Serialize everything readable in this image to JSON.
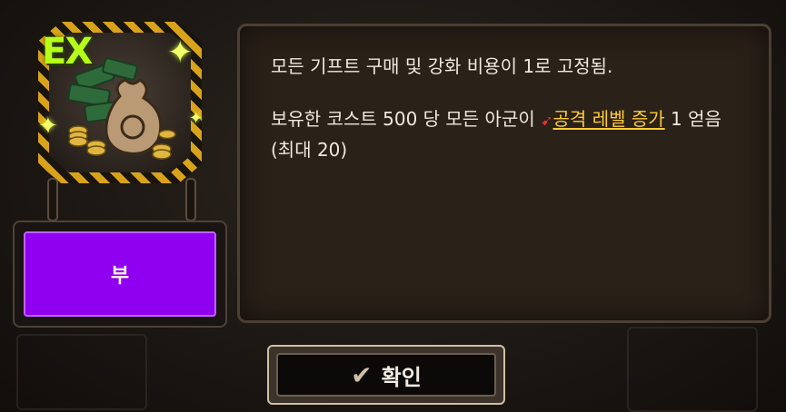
{
  "card": {
    "badge": "EX",
    "icon": "money-bag-icon"
  },
  "label": "부",
  "description": {
    "line1": "모든 기프트 구매 및 강화 비용이 1로 고정됨.",
    "line2_prefix": "보유한 코스트 500 당 모든 아군이 ",
    "line2_highlight": "공격 레벨 증가",
    "line2_suffix": " 1 얻음 (최대 20)"
  },
  "confirm_button": {
    "label": "확인",
    "icon": "checkmark-icon"
  },
  "colors": {
    "label_bg": "#8f00f0",
    "highlight": "#ffcc33",
    "badge": "#b6ff1a"
  }
}
